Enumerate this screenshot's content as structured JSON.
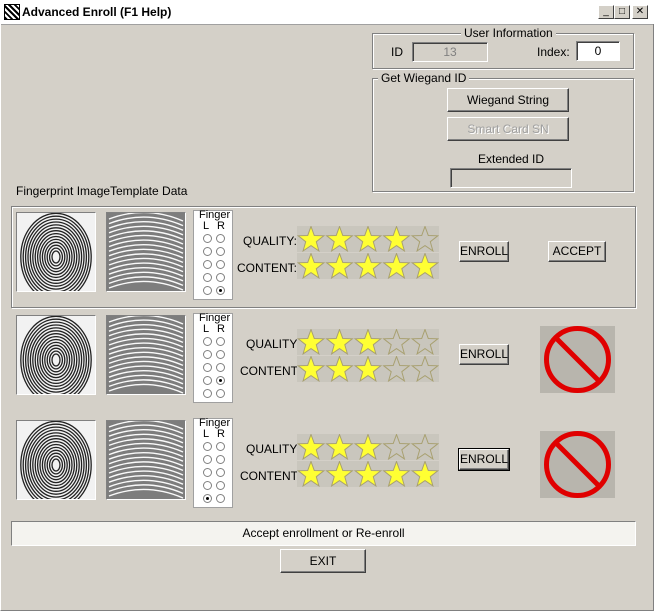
{
  "window": {
    "title": "Advanced Enroll (F1 Help)",
    "min_glyph": "_",
    "max_glyph": "□",
    "close_glyph": "✕"
  },
  "user_info": {
    "legend": "User Information",
    "id_label": "ID",
    "id_value": "13",
    "index_label": "Index:",
    "index_value": "0"
  },
  "wiegand": {
    "legend": "Get Wiegand ID",
    "wiegand_button": "Wiegand String",
    "smartcard_button": "Smart Card SN",
    "extended_label": "Extended ID",
    "extended_value": ""
  },
  "headers": {
    "fingerprint_image": "Fingerprint Image",
    "template_data": "Template Data"
  },
  "rows": [
    {
      "finger_label": "Finger",
      "l": "L",
      "r": "R",
      "quality_label": "QUALITY:",
      "content_label": "CONTENT:",
      "quality": 4,
      "content": 5,
      "enroll": "ENROLL",
      "accept": "ACCEPT",
      "selected": "R5"
    },
    {
      "finger_label": "Finger",
      "l": "L",
      "r": "R",
      "quality_label": "QUALITY:",
      "content_label": "CONTENT:",
      "quality": 3,
      "content": 3,
      "enroll": "ENROLL",
      "selected": "R4"
    },
    {
      "finger_label": "Finger",
      "l": "L",
      "r": "R",
      "quality_label": "QUALITY:",
      "content_label": "CONTENT:",
      "quality": 3,
      "content": 5,
      "enroll": "ENROLL",
      "selected": "L5"
    }
  ],
  "status_text": "Accept enrollment or Re-enroll",
  "exit_label": "EXIT",
  "colors": {
    "star_fill": "#ffff33",
    "star_empty": "#c9c6bd",
    "prohibit": "#e00000"
  }
}
